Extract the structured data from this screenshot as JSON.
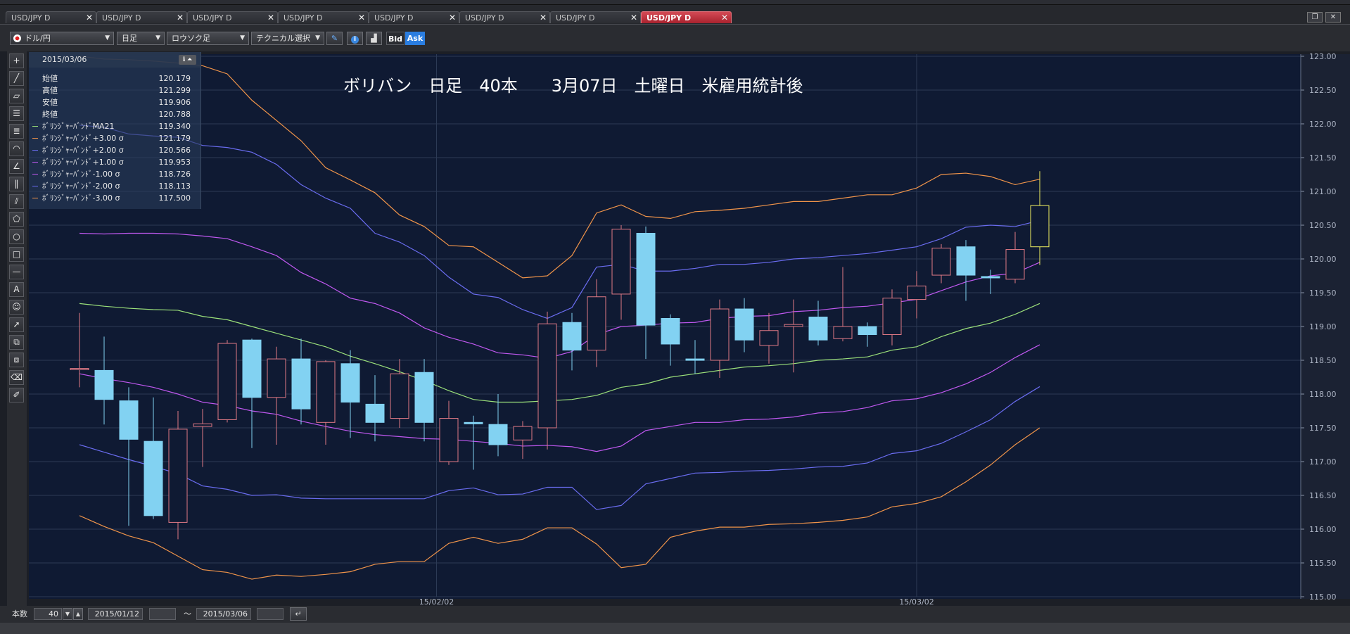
{
  "tabs": [
    {
      "label": "USD/JPY D",
      "close": "✕",
      "active": false
    },
    {
      "label": "USD/JPY D",
      "close": "✕",
      "active": false
    },
    {
      "label": "USD/JPY D",
      "close": "✕",
      "active": false
    },
    {
      "label": "USD/JPY D",
      "close": "✕",
      "active": false
    },
    {
      "label": "USD/JPY D",
      "close": "✕",
      "active": false
    },
    {
      "label": "USD/JPY D",
      "close": "✕",
      "active": false
    },
    {
      "label": "USD/JPY D",
      "close": "✕",
      "active": false
    },
    {
      "label": "USD/JPY D",
      "close": "✕",
      "active": true
    }
  ],
  "toolbar": {
    "pair": "ドル/円",
    "period": "日足",
    "chart_type": "ロウソク足",
    "technical": "テクニカル選択",
    "bid": "Bid",
    "ask": "Ask"
  },
  "info": {
    "date": "2015/03/06",
    "rows": [
      {
        "label": "始値",
        "value": "120.179",
        "color": ""
      },
      {
        "label": "高値",
        "value": "121.299",
        "color": ""
      },
      {
        "label": "安値",
        "value": "119.906",
        "color": ""
      },
      {
        "label": "終値",
        "value": "120.788",
        "color": ""
      },
      {
        "label": "ﾎﾞﾘﾝｼﾞｬｰﾊﾞﾝﾄﾞMA21",
        "value": "119.340",
        "color": "#9be07a"
      },
      {
        "label": "ﾎﾞﾘﾝｼﾞｬｰﾊﾞﾝﾄﾞ+3.00 σ",
        "value": "121.179",
        "color": "#f0944a"
      },
      {
        "label": "ﾎﾞﾘﾝｼﾞｬｰﾊﾞﾝﾄﾞ+2.00 σ",
        "value": "120.566",
        "color": "#6a6cf0"
      },
      {
        "label": "ﾎﾞﾘﾝｼﾞｬｰﾊﾞﾝﾄﾞ+1.00 σ",
        "value": "119.953",
        "color": "#c058f0"
      },
      {
        "label": "ﾎﾞﾘﾝｼﾞｬｰﾊﾞﾝﾄﾞ-1.00 σ",
        "value": "118.726",
        "color": "#c058f0"
      },
      {
        "label": "ﾎﾞﾘﾝｼﾞｬｰﾊﾞﾝﾄﾞ-2.00 σ",
        "value": "118.113",
        "color": "#6a6cf0"
      },
      {
        "label": "ﾎﾞﾘﾝｼﾞｬｰﾊﾞﾝﾄﾞ-3.00 σ",
        "value": "117.500",
        "color": "#f0944a"
      }
    ]
  },
  "bottom": {
    "count_label": "本数",
    "count": "40",
    "from": "2015/01/12",
    "tilde": "〜",
    "to": "2015/03/06"
  },
  "chart_data": {
    "type": "candlestick",
    "title": "ボリバン　日足　40本　　3月07日　土曜日　米雇用統計後",
    "ylim": [
      115.0,
      123.0
    ],
    "y_ticks": [
      "115.00",
      "115.50",
      "116.00",
      "116.50",
      "117.00",
      "117.50",
      "118.00",
      "118.50",
      "119.00",
      "119.50",
      "120.00",
      "120.50",
      "121.00",
      "121.50",
      "122.00",
      "122.50",
      "123.00"
    ],
    "x_labels": [
      {
        "index": 14.5,
        "label": "15/02/02"
      },
      {
        "index": 34,
        "label": "15/03/02"
      }
    ],
    "candles": [
      {
        "o": 118.38,
        "h": 119.2,
        "l": 118.1,
        "c": 118.38
      },
      {
        "o": 118.35,
        "h": 118.85,
        "l": 117.55,
        "c": 117.92
      },
      {
        "o": 117.9,
        "h": 118.1,
        "l": 116.05,
        "c": 117.33
      },
      {
        "o": 117.3,
        "h": 117.95,
        "l": 116.15,
        "c": 116.2
      },
      {
        "o": 116.1,
        "h": 117.75,
        "l": 115.85,
        "c": 117.48
      },
      {
        "o": 117.52,
        "h": 117.78,
        "l": 116.92,
        "c": 117.56
      },
      {
        "o": 117.62,
        "h": 118.8,
        "l": 117.58,
        "c": 118.75
      },
      {
        "o": 118.8,
        "h": 118.82,
        "l": 117.2,
        "c": 117.95
      },
      {
        "o": 117.95,
        "h": 118.7,
        "l": 117.25,
        "c": 118.52
      },
      {
        "o": 118.52,
        "h": 118.82,
        "l": 117.55,
        "c": 117.78
      },
      {
        "o": 117.58,
        "h": 118.5,
        "l": 117.25,
        "c": 118.48
      },
      {
        "o": 118.45,
        "h": 118.65,
        "l": 117.35,
        "c": 117.88
      },
      {
        "o": 117.85,
        "h": 118.28,
        "l": 117.3,
        "c": 117.58
      },
      {
        "o": 117.64,
        "h": 118.52,
        "l": 117.5,
        "c": 118.3
      },
      {
        "o": 118.32,
        "h": 118.52,
        "l": 117.3,
        "c": 117.58
      },
      {
        "o": 117.0,
        "h": 117.9,
        "l": 116.95,
        "c": 117.64
      },
      {
        "o": 117.58,
        "h": 117.68,
        "l": 116.88,
        "c": 117.56
      },
      {
        "o": 117.55,
        "h": 118.0,
        "l": 117.08,
        "c": 117.25
      },
      {
        "o": 117.32,
        "h": 117.6,
        "l": 117.04,
        "c": 117.52
      },
      {
        "o": 117.5,
        "h": 119.22,
        "l": 117.18,
        "c": 119.04
      },
      {
        "o": 119.06,
        "h": 119.2,
        "l": 118.35,
        "c": 118.65
      },
      {
        "o": 118.65,
        "h": 119.7,
        "l": 118.4,
        "c": 119.44
      },
      {
        "o": 119.48,
        "h": 120.5,
        "l": 119.1,
        "c": 120.44
      },
      {
        "o": 120.38,
        "h": 120.48,
        "l": 118.52,
        "c": 119.02
      },
      {
        "o": 119.12,
        "h": 119.18,
        "l": 118.42,
        "c": 118.74
      },
      {
        "o": 118.52,
        "h": 118.8,
        "l": 118.3,
        "c": 118.5
      },
      {
        "o": 118.5,
        "h": 119.4,
        "l": 118.24,
        "c": 119.26
      },
      {
        "o": 119.26,
        "h": 119.42,
        "l": 118.62,
        "c": 118.8
      },
      {
        "o": 118.72,
        "h": 119.2,
        "l": 118.45,
        "c": 118.94
      },
      {
        "o": 119.0,
        "h": 119.4,
        "l": 118.32,
        "c": 119.03
      },
      {
        "o": 119.14,
        "h": 119.38,
        "l": 118.72,
        "c": 118.8
      },
      {
        "o": 118.82,
        "h": 119.88,
        "l": 118.78,
        "c": 119.0
      },
      {
        "o": 119.0,
        "h": 119.06,
        "l": 118.7,
        "c": 118.88
      },
      {
        "o": 118.88,
        "h": 119.55,
        "l": 118.72,
        "c": 119.42
      },
      {
        "o": 119.4,
        "h": 119.82,
        "l": 119.12,
        "c": 119.6
      },
      {
        "o": 119.76,
        "h": 120.22,
        "l": 119.64,
        "c": 120.16
      },
      {
        "o": 120.18,
        "h": 120.28,
        "l": 119.38,
        "c": 119.76
      },
      {
        "o": 119.74,
        "h": 119.84,
        "l": 119.48,
        "c": 119.72
      },
      {
        "o": 119.7,
        "h": 120.4,
        "l": 119.64,
        "c": 120.14
      },
      {
        "o": 120.18,
        "h": 121.3,
        "l": 119.91,
        "c": 120.79
      }
    ],
    "series": [
      {
        "name": "ﾎﾞﾘﾝｼﾞｬｰﾊﾞﾝﾄﾞMA21",
        "color": "#9be07a",
        "values": [
          119.34,
          119.3,
          119.27,
          119.25,
          119.24,
          119.15,
          119.1,
          119.0,
          118.9,
          118.8,
          118.7,
          118.56,
          118.45,
          118.33,
          118.2,
          118.05,
          117.92,
          117.88,
          117.88,
          117.9,
          117.92,
          117.98,
          118.1,
          118.15,
          118.25,
          118.3,
          118.35,
          118.4,
          118.42,
          118.45,
          118.5,
          118.52,
          118.55,
          118.65,
          118.7,
          118.85,
          118.97,
          119.05,
          119.18,
          119.34
        ]
      },
      {
        "name": "ﾎﾞﾘﾝｼﾞｬｰﾊﾞﾝﾄﾞ+3.00 σ",
        "color": "#f0944a",
        "values": [
          123.0,
          122.96,
          122.95,
          122.93,
          122.9,
          122.86,
          122.74,
          122.35,
          122.05,
          121.75,
          121.35,
          121.17,
          120.98,
          120.65,
          120.48,
          120.2,
          120.18,
          119.95,
          119.72,
          119.75,
          120.05,
          120.68,
          120.8,
          120.63,
          120.6,
          120.7,
          120.72,
          120.75,
          120.8,
          120.85,
          120.85,
          120.9,
          120.95,
          120.95,
          121.05,
          121.25,
          121.27,
          121.22,
          121.1,
          121.18
        ]
      },
      {
        "name": "ﾎﾞﾘﾝｼﾞｬｰﾊﾞﾝﾄﾞ+2.00 σ",
        "color": "#6a6cf0",
        "values": [
          121.98,
          121.95,
          121.85,
          121.82,
          121.8,
          121.68,
          121.65,
          121.58,
          121.4,
          121.1,
          120.9,
          120.75,
          120.38,
          120.25,
          120.05,
          119.73,
          119.48,
          119.43,
          119.25,
          119.12,
          119.28,
          119.88,
          119.92,
          119.82,
          119.82,
          119.86,
          119.92,
          119.92,
          119.95,
          120.0,
          120.02,
          120.05,
          120.08,
          120.13,
          120.18,
          120.3,
          120.47,
          120.5,
          120.48,
          120.57
        ]
      },
      {
        "name": "ﾎﾞﾘﾝｼﾞｬｰﾊﾞﾝﾄﾞ+1.00 σ",
        "color": "#c058f0",
        "values": [
          120.38,
          120.37,
          120.38,
          120.38,
          120.37,
          120.34,
          120.3,
          120.18,
          120.05,
          119.8,
          119.63,
          119.42,
          119.34,
          119.2,
          118.98,
          118.84,
          118.74,
          118.61,
          118.58,
          118.53,
          118.63,
          118.88,
          119.0,
          119.02,
          119.05,
          119.06,
          119.12,
          119.15,
          119.16,
          119.22,
          119.24,
          119.28,
          119.3,
          119.35,
          119.4,
          119.53,
          119.66,
          119.75,
          119.79,
          119.95
        ]
      },
      {
        "name": "ﾎﾞﾘﾝｼﾞｬｰﾊﾞﾝﾄﾞ-1.00 σ",
        "color": "#c058f0",
        "values": [
          118.3,
          118.23,
          118.17,
          118.1,
          118.0,
          117.88,
          117.83,
          117.75,
          117.7,
          117.6,
          117.52,
          117.45,
          117.4,
          117.37,
          117.34,
          117.33,
          117.3,
          117.27,
          117.23,
          117.24,
          117.22,
          117.15,
          117.23,
          117.46,
          117.52,
          117.58,
          117.58,
          117.62,
          117.63,
          117.66,
          117.72,
          117.74,
          117.8,
          117.9,
          117.93,
          118.02,
          118.15,
          118.32,
          118.54,
          118.73
        ]
      },
      {
        "name": "ﾎﾞﾘﾝｼﾞｬｰﾊﾞﾝﾄﾞ-2.00 σ",
        "color": "#6a6cf0",
        "values": [
          117.25,
          117.14,
          117.03,
          116.93,
          116.82,
          116.64,
          116.59,
          116.5,
          116.51,
          116.46,
          116.45,
          116.45,
          116.45,
          116.45,
          116.45,
          116.57,
          116.61,
          116.51,
          116.52,
          116.62,
          116.62,
          116.29,
          116.35,
          116.67,
          116.75,
          116.83,
          116.84,
          116.86,
          116.87,
          116.89,
          116.92,
          116.93,
          116.98,
          117.12,
          117.16,
          117.27,
          117.44,
          117.62,
          117.89,
          118.11
        ]
      },
      {
        "name": "ﾎﾞﾘﾝｼﾞｬｰﾊﾞﾝﾄﾞ-3.00 σ",
        "color": "#f0944a",
        "values": [
          116.2,
          116.04,
          115.9,
          115.8,
          115.6,
          115.4,
          115.36,
          115.26,
          115.32,
          115.3,
          115.33,
          115.37,
          115.48,
          115.52,
          115.52,
          115.79,
          115.88,
          115.79,
          115.85,
          116.02,
          116.02,
          115.78,
          115.43,
          115.48,
          115.88,
          115.97,
          116.03,
          116.03,
          116.07,
          116.08,
          116.1,
          116.13,
          116.18,
          116.33,
          116.38,
          116.48,
          116.7,
          116.95,
          117.25,
          117.5
        ]
      }
    ]
  },
  "colors": {
    "bg_plot": "#0f1a33",
    "grid": "#2c3a55",
    "candle_up_fill": "#0f1a33",
    "candle_up_border": "#e07a86",
    "candle_down_fill": "#82d2f2",
    "last_candle": "#f0f060"
  }
}
